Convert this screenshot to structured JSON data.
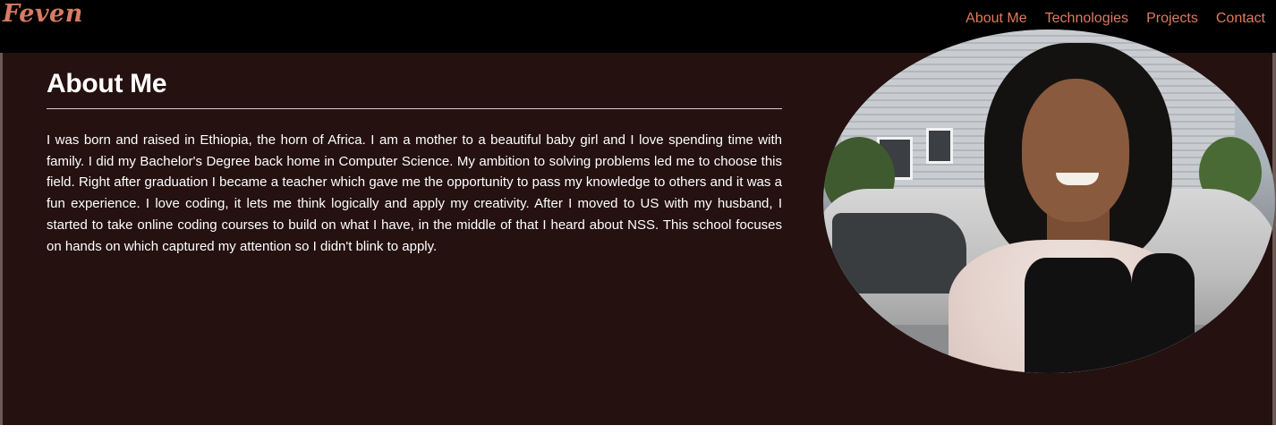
{
  "brand": {
    "name": "Feven"
  },
  "nav": {
    "items": [
      {
        "label": "About Me"
      },
      {
        "label": "Technologies"
      },
      {
        "label": "Projects"
      },
      {
        "label": "Contact"
      }
    ]
  },
  "about": {
    "title": "About Me",
    "paragraph": "I was born and raised in Ethiopia, the horn of Africa. I am a mother to a beautiful baby girl and I love spending time with family. I did my Bachelor's Degree back home in Computer Science. My ambition to solving problems led me to choose this field. Right after graduation I became a teacher which gave me the opportunity to pass my knowledge to others and it was a fun experience. I love coding, it lets me think logically and apply my creativity. After I moved to US with my husband, I started to take online coding courses to build on what I have, in the middle of that I heard about NSS. This school focuses on hands on which captured my attention so I didn't blink to apply."
  },
  "colors": {
    "navbar_bg": "#000000",
    "accent": "#e07a5f",
    "section_bg": "#241110",
    "text": "#ffffff"
  }
}
